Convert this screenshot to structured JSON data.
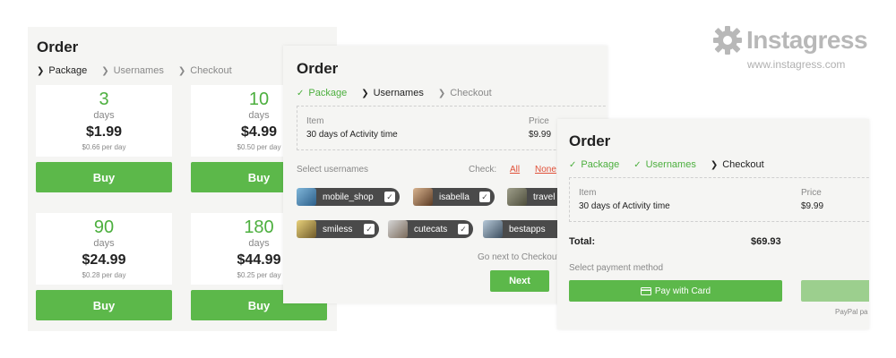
{
  "logo": {
    "brand": "Instagress",
    "url": "www.instagress.com"
  },
  "panel1": {
    "title": "Order",
    "steps": [
      "Package",
      "Usernames",
      "Checkout"
    ],
    "packages": [
      {
        "num": "3",
        "unit": "days",
        "price": "$1.99",
        "per": "$0.66 per day",
        "buy": "Buy"
      },
      {
        "num": "10",
        "unit": "days",
        "price": "$4.99",
        "per": "$0.50 per day",
        "buy": "Buy"
      },
      {
        "num": "90",
        "unit": "days",
        "price": "$24.99",
        "per": "$0.28 per day",
        "buy": "Buy"
      },
      {
        "num": "180",
        "unit": "days",
        "price": "$44.99",
        "per": "$0.25 per day",
        "buy": "Buy"
      }
    ]
  },
  "panel2": {
    "title": "Order",
    "steps": [
      "Package",
      "Usernames",
      "Checkout"
    ],
    "item_label": "Item",
    "item_value": "30 days of Activity time",
    "price_label": "Price",
    "price_value": "$9.99",
    "select_label": "Select usernames",
    "check_label": "Check:",
    "check_all": "All",
    "check_none": "None",
    "usernames": [
      "mobile_shop",
      "isabella",
      "travel",
      "smiless",
      "cutecats",
      "bestapps"
    ],
    "next_hint": "Go next to Checkout",
    "next_button": "Next"
  },
  "panel3": {
    "title": "Order",
    "steps": [
      "Package",
      "Usernames",
      "Checkout"
    ],
    "item_label": "Item",
    "item_value": "30 days of Activity time",
    "price_label": "Price",
    "price_value": "$9.99",
    "total_label": "Total:",
    "total_value": "$69.93",
    "payment_label": "Select payment method",
    "pay_card": "Pay with Card",
    "paypal_label": "PayPal pa"
  },
  "colors": {
    "accent": "#5cb84a",
    "accent_text": "#4caf3e",
    "chip": "#4a4a4a",
    "link": "#e05038"
  }
}
